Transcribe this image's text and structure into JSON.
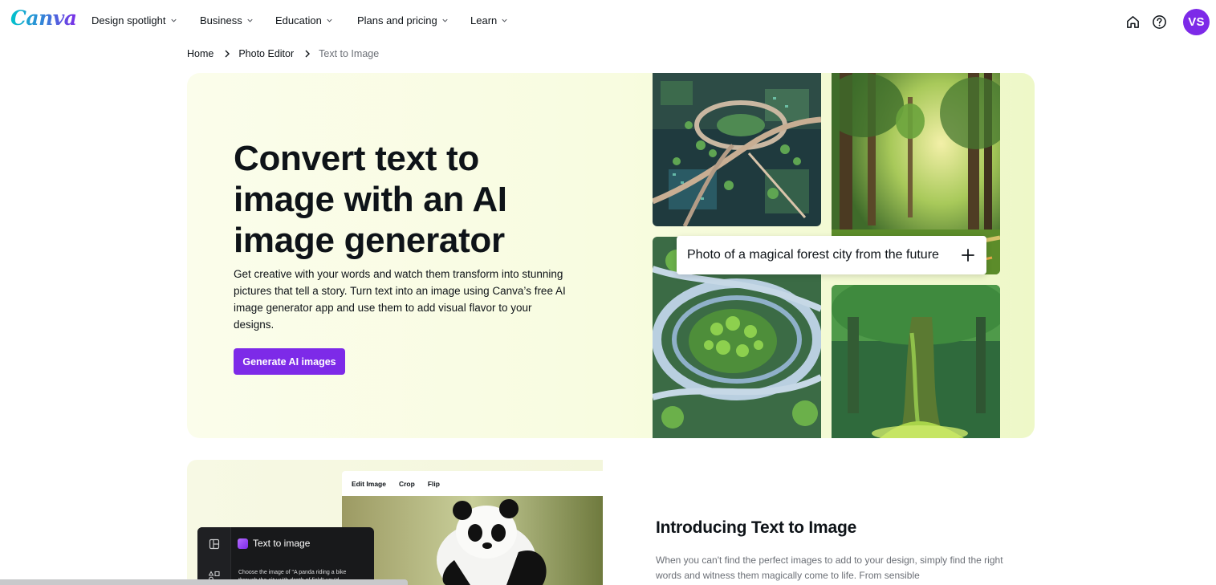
{
  "brand": {
    "logo_text": "Canva",
    "accent": "#7d2ae8",
    "logo_gradient": [
      "#00c4cc",
      "#3b7bd9",
      "#7d2ae8"
    ]
  },
  "nav": {
    "items": [
      {
        "label": "Design spotlight",
        "icon": "chevron-down-icon"
      },
      {
        "label": "Business",
        "icon": "chevron-down-icon"
      },
      {
        "label": "Education",
        "icon": "chevron-down-icon"
      },
      {
        "label": "Plans and pricing",
        "icon": "chevron-down-icon"
      },
      {
        "label": "Learn",
        "icon": "chevron-down-icon"
      }
    ],
    "icons": [
      "home-icon",
      "help-icon"
    ],
    "avatar_initials": "VS"
  },
  "breadcrumb": {
    "items": [
      "Home",
      "Photo Editor"
    ],
    "current": "Text to Image",
    "separator_icon": "chevron-right-icon"
  },
  "hero": {
    "title": "Convert text to image with an AI image generator",
    "description": "Get creative with your words and watch them transform into stunning pictures that tell a story. Turn text into an image using Canva’s free AI image generator app and use them to add visual flavor to your designs.",
    "cta_label": "Generate AI images",
    "prompt_text": "Photo of a magical forest city from the future",
    "prompt_icon": "plus-icon",
    "background": "#f8fce0"
  },
  "editor_preview": {
    "toolbar": [
      "Edit Image",
      "Crop",
      "Flip"
    ],
    "panel_title": "Text to image",
    "panel_note": "Choose the image of \"A panda riding a bike through the city with depth of field\" you'd"
  },
  "intro": {
    "title": "Introducing Text to Image",
    "body": "When you can't find the perfect images to add to your design, simply find the right words and witness them magically come to life. From sensible"
  }
}
